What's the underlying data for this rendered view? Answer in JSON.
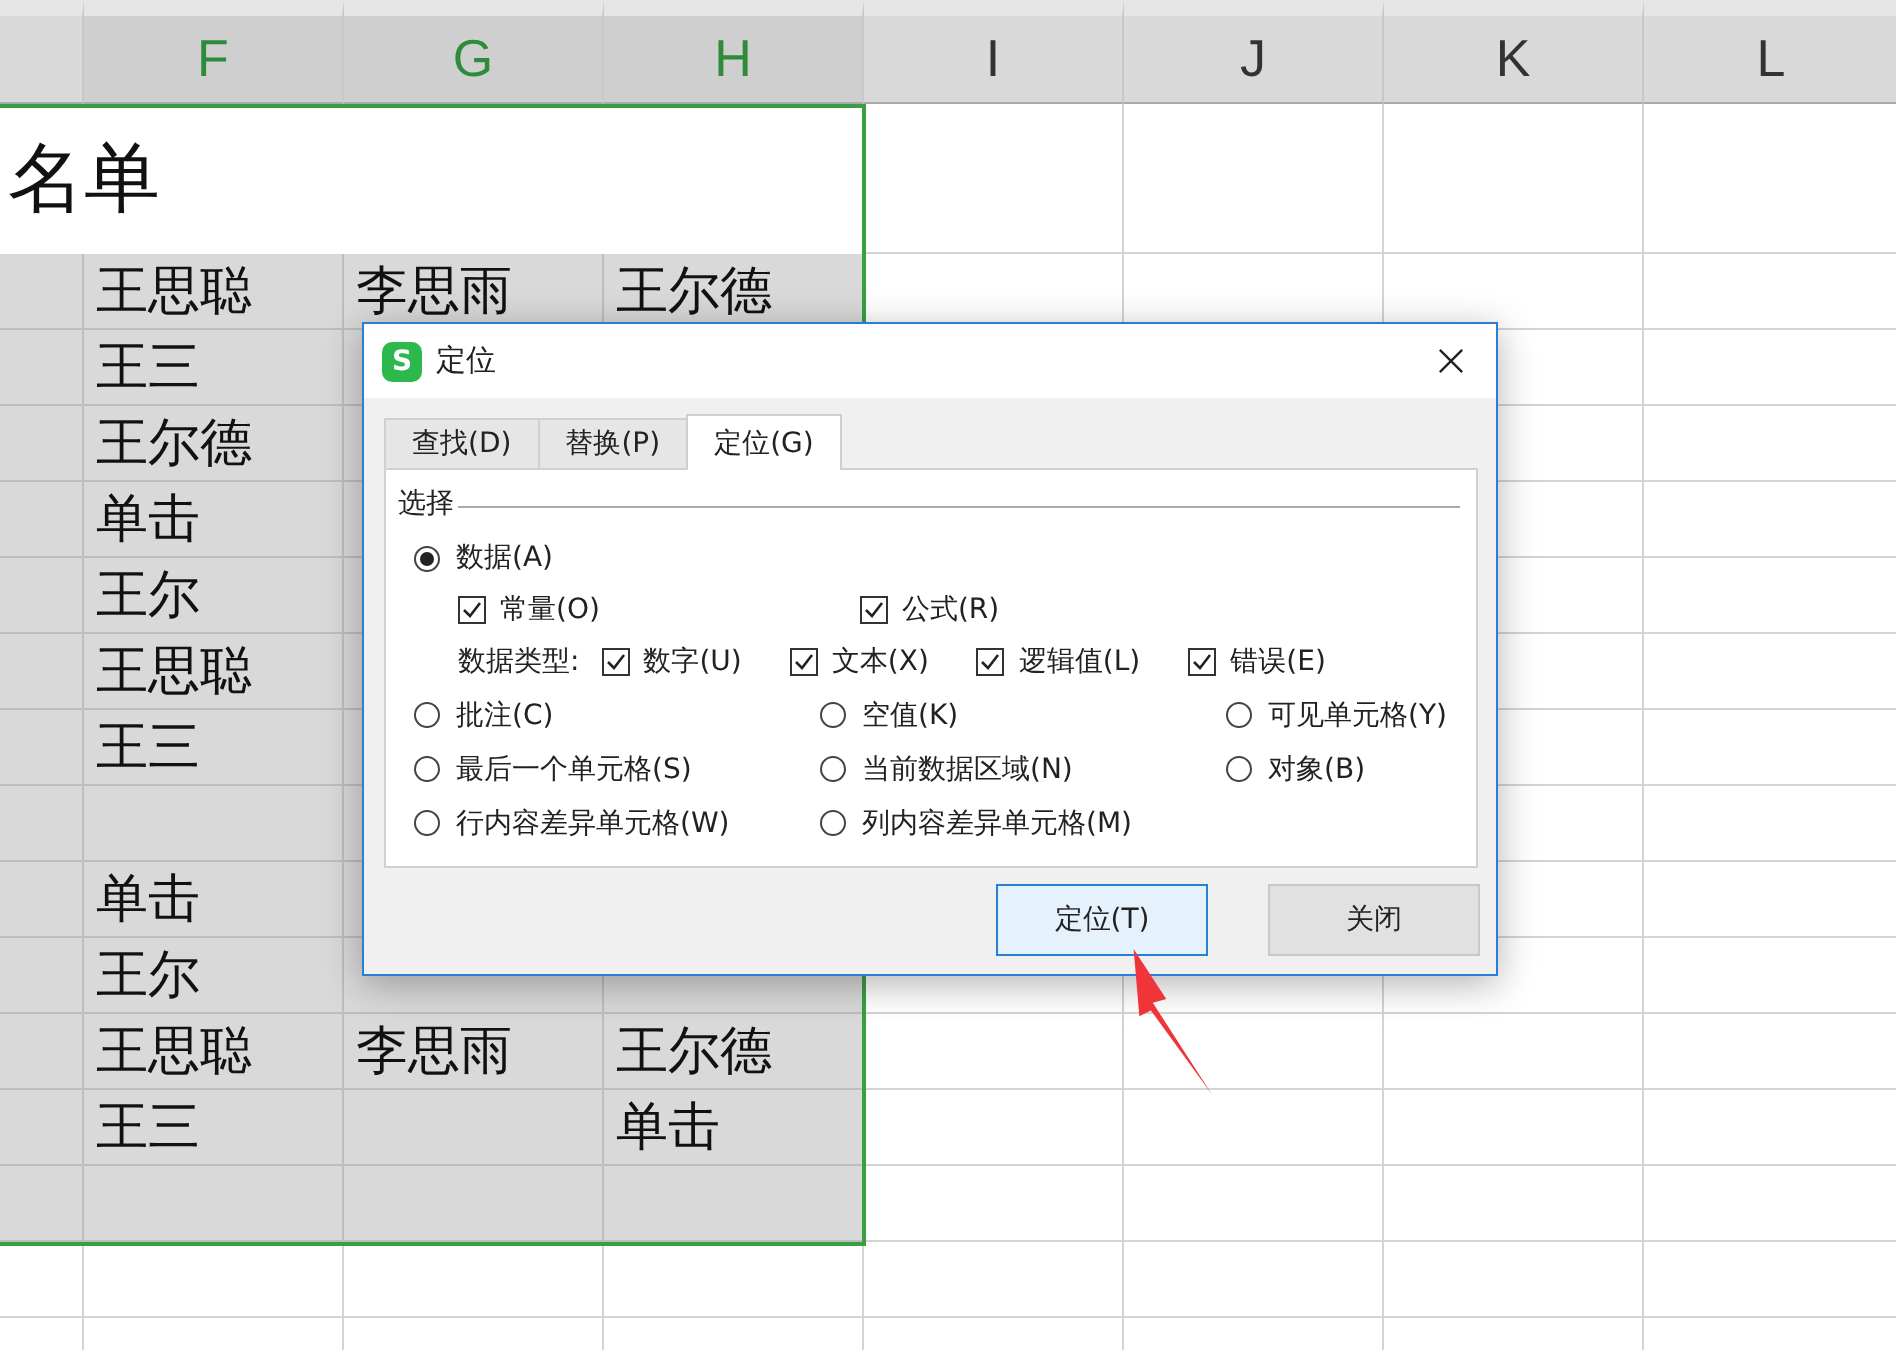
{
  "sheet": {
    "columns": [
      {
        "label": "F",
        "selected": true
      },
      {
        "label": "G",
        "selected": true
      },
      {
        "label": "H",
        "selected": true
      },
      {
        "label": "I",
        "selected": false
      },
      {
        "label": "J",
        "selected": false
      },
      {
        "label": "K",
        "selected": false
      },
      {
        "label": "L",
        "selected": false
      }
    ],
    "title": "名单",
    "rows": [
      {
        "cells": [
          "王思聪",
          "李思雨",
          "王尔德"
        ]
      },
      {
        "cells": [
          "王三",
          null,
          null
        ]
      },
      {
        "cells": [
          "王尔德",
          null,
          null
        ]
      },
      {
        "cells": [
          "单击",
          null,
          null
        ]
      },
      {
        "cells": [
          "王尔",
          null,
          null
        ]
      },
      {
        "cells": [
          "王思聪",
          null,
          null
        ]
      },
      {
        "cells": [
          "王三",
          null,
          null
        ]
      },
      {
        "cells": [
          null,
          null,
          null
        ]
      },
      {
        "cells": [
          "单击",
          null,
          null
        ]
      },
      {
        "cells": [
          "王尔",
          null,
          null
        ]
      },
      {
        "cells": [
          "王思聪",
          "李思雨",
          "王尔德"
        ]
      },
      {
        "cells": [
          "王三",
          null,
          "单击"
        ]
      },
      {
        "cells": [
          null,
          null,
          null
        ]
      }
    ]
  },
  "dialog": {
    "icon_letter": "S",
    "title": "定位",
    "tabs": [
      {
        "label": "查找(D)",
        "selected": false
      },
      {
        "label": "替换(P)",
        "selected": false
      },
      {
        "label": "定位(G)",
        "selected": true
      }
    ],
    "group_label": "选择",
    "data_option": {
      "label": "数据(A)",
      "selected": true
    },
    "value_checks": [
      {
        "label": "常量(O)",
        "checked": true
      },
      {
        "label": "公式(R)",
        "checked": true
      }
    ],
    "type_label": "数据类型:",
    "type_checks": [
      {
        "label": "数字(U)",
        "checked": true
      },
      {
        "label": "文本(X)",
        "checked": true
      },
      {
        "label": "逻辑值(L)",
        "checked": true
      },
      {
        "label": "错误(E)",
        "checked": true
      }
    ],
    "options": [
      {
        "label": "批注(C)",
        "selected": false
      },
      {
        "label": "空值(K)",
        "selected": false
      },
      {
        "label": "可见单元格(Y)",
        "selected": false
      },
      {
        "label": "最后一个单元格(S)",
        "selected": false
      },
      {
        "label": "当前数据区域(N)",
        "selected": false
      },
      {
        "label": "对象(B)",
        "selected": false
      },
      {
        "label": "行内容差异单元格(W)",
        "selected": false
      },
      {
        "label": "列内容差异单元格(M)",
        "selected": false
      }
    ],
    "buttons": [
      {
        "label": "定位(T)",
        "focused": true
      },
      {
        "label": "关闭",
        "focused": false
      }
    ]
  }
}
